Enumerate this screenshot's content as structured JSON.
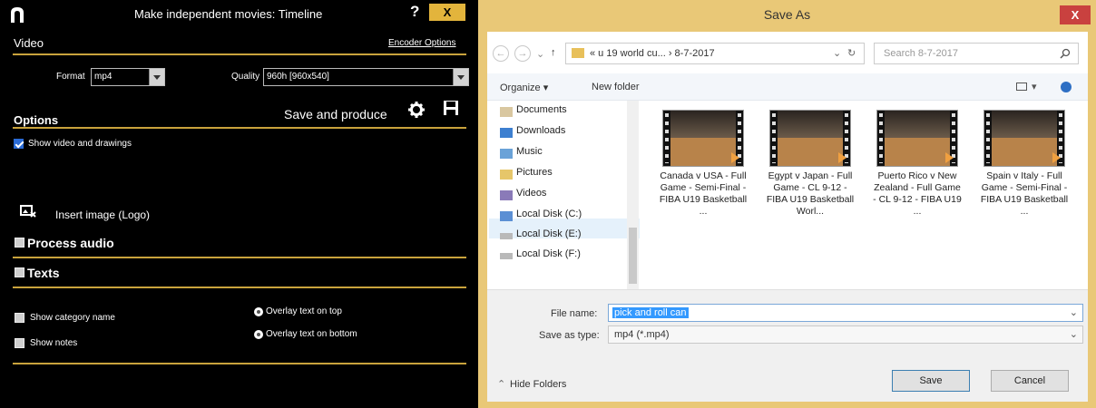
{
  "app": {
    "title": "Make independent movies: Timeline",
    "help": "?",
    "close": "X",
    "video_section": "Video",
    "encoder_options": "Encoder Options",
    "format_label": "Format",
    "format_value": "mp4",
    "quality_label": "Quality",
    "quality_value": "960h [960x540]",
    "save_produce": "Save and produce",
    "options_section": "Options",
    "show_video_drawings": "Show video and drawings",
    "insert_image": "Insert image (Logo)",
    "process_audio": "Process audio",
    "texts": "Texts",
    "show_category_name": "Show category name",
    "show_notes": "Show notes",
    "overlay_top": "Overlay text on top",
    "overlay_bottom": "Overlay text on bottom"
  },
  "dialog": {
    "title": "Save As",
    "close": "X",
    "path": "« u 19 world cu...  ›  8-7-2017",
    "search_placeholder": "Search 8-7-2017",
    "organize": "Organize ▾",
    "new_folder": "New folder",
    "nav_items": [
      {
        "label": "Documents",
        "icon": "documents-icon"
      },
      {
        "label": "Downloads",
        "icon": "downloads-icon"
      },
      {
        "label": "Music",
        "icon": "music-icon"
      },
      {
        "label": "Pictures",
        "icon": "pictures-icon"
      },
      {
        "label": "Videos",
        "icon": "videos-icon"
      },
      {
        "label": "Local Disk (C:)",
        "icon": "local-disk-icon"
      },
      {
        "label": "Local Disk (E:)",
        "icon": "drive-icon",
        "selected": true
      },
      {
        "label": "Local Disk (F:)",
        "icon": "drive-icon"
      }
    ],
    "files": [
      {
        "name": "Canada v USA - Full Game - Semi-Final - FIBA U19 Basketball ..."
      },
      {
        "name": "Egypt v Japan - Full Game - CL 9-12 - FIBA U19 Basketball Worl..."
      },
      {
        "name": "Puerto Rico v New Zealand - Full Game - CL 9-12 - FIBA U19 ..."
      },
      {
        "name": "Spain v Italy - Full Game - Semi-Final - FIBA U19 Basketball ..."
      }
    ],
    "file_name_label": "File name:",
    "file_name_value": "pick and roll can",
    "save_type_label": "Save as type:",
    "save_type_value": "mp4 (*.mp4)",
    "hide_folders": "Hide Folders",
    "save": "Save",
    "cancel": "Cancel"
  },
  "colors": {
    "accent_gold": "#c9a33c",
    "dialog_frame": "#e9c877",
    "close_red": "#c9413f",
    "selection_blue": "#3399ff"
  }
}
